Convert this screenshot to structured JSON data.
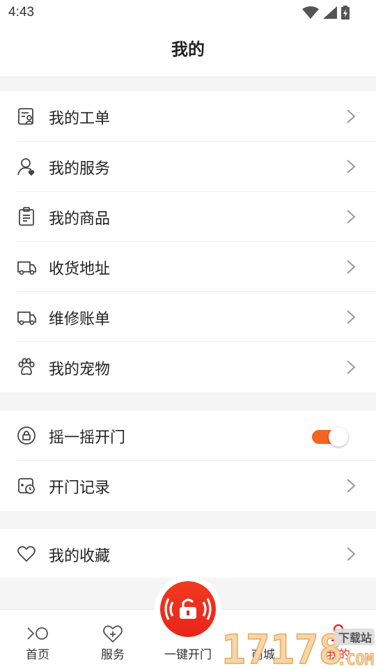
{
  "status": {
    "time": "4:43"
  },
  "header": {
    "title": "我的"
  },
  "menu_group_1": [
    {
      "label": "我的工单",
      "icon": "work-order-icon"
    },
    {
      "label": "我的服务",
      "icon": "user-service-icon"
    },
    {
      "label": "我的商品",
      "icon": "clipboard-icon"
    },
    {
      "label": "收货地址",
      "icon": "truck-icon"
    },
    {
      "label": "维修账单",
      "icon": "truck-icon"
    },
    {
      "label": "我的宠物",
      "icon": "paw-icon"
    }
  ],
  "menu_group_2": [
    {
      "label": "摇一摇开门",
      "icon": "lock-icon",
      "toggle_on": true
    },
    {
      "label": "开门记录",
      "icon": "door-clock-icon"
    }
  ],
  "menu_group_3": [
    {
      "label": "我的收藏",
      "icon": "heart-icon"
    }
  ],
  "tabbar": {
    "tabs": [
      {
        "label": "首页",
        "active": false
      },
      {
        "label": "服务",
        "active": false
      },
      {
        "label": "一键开门",
        "active": false
      },
      {
        "label": "商城",
        "active": false
      },
      {
        "label": "我的",
        "active": true
      }
    ]
  },
  "colors": {
    "accent": "#f26522",
    "active_tab": "#e02020",
    "fab": "#e8241a"
  },
  "watermark": {
    "text_main": "17178",
    "text_badge": "下载站",
    "text_sub": ".COM"
  }
}
